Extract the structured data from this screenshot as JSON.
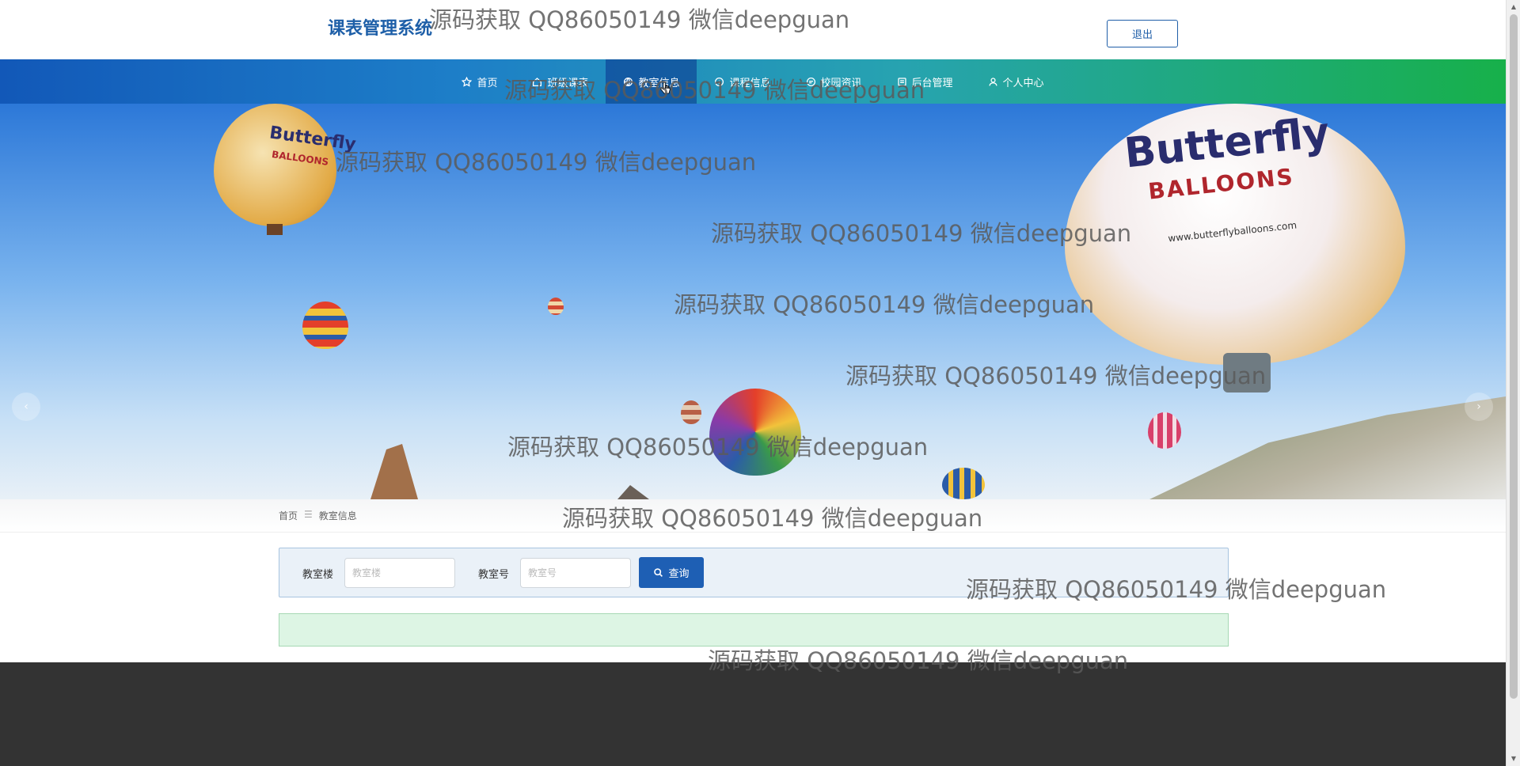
{
  "header": {
    "site_title": "课表管理系统",
    "logout_label": "退出"
  },
  "nav": {
    "items": [
      {
        "label": "首页",
        "icon": "star-icon"
      },
      {
        "label": "班级课表",
        "icon": "home-icon"
      },
      {
        "label": "教室信息",
        "icon": "globe-icon"
      },
      {
        "label": "课程信息",
        "icon": "info-icon"
      },
      {
        "label": "校园资讯",
        "icon": "chat-icon"
      },
      {
        "label": "后台管理",
        "icon": "monitor-icon"
      },
      {
        "label": "个人中心",
        "icon": "user-icon"
      }
    ],
    "active_index": 2
  },
  "banner": {
    "balloon_brand": "Butterfly",
    "balloon_sub": "BALLOONS",
    "balloon_url": "www.butterflyballoons.com",
    "prev_arrow": "‹",
    "next_arrow": "›"
  },
  "breadcrumb": {
    "home": "首页",
    "separator": "☰",
    "current": "教室信息"
  },
  "search": {
    "building_label": "教室楼",
    "building_placeholder": "教室楼",
    "room_label": "教室号",
    "room_placeholder": "教室号",
    "query_label": "查询"
  },
  "watermark_text": "源码获取 QQ86050149 微信deepguan",
  "colors": {
    "title_blue": "#1e5fa8",
    "button_blue": "#1e5fb4",
    "footer": "#333333",
    "result_green": "#ddf5e4"
  }
}
